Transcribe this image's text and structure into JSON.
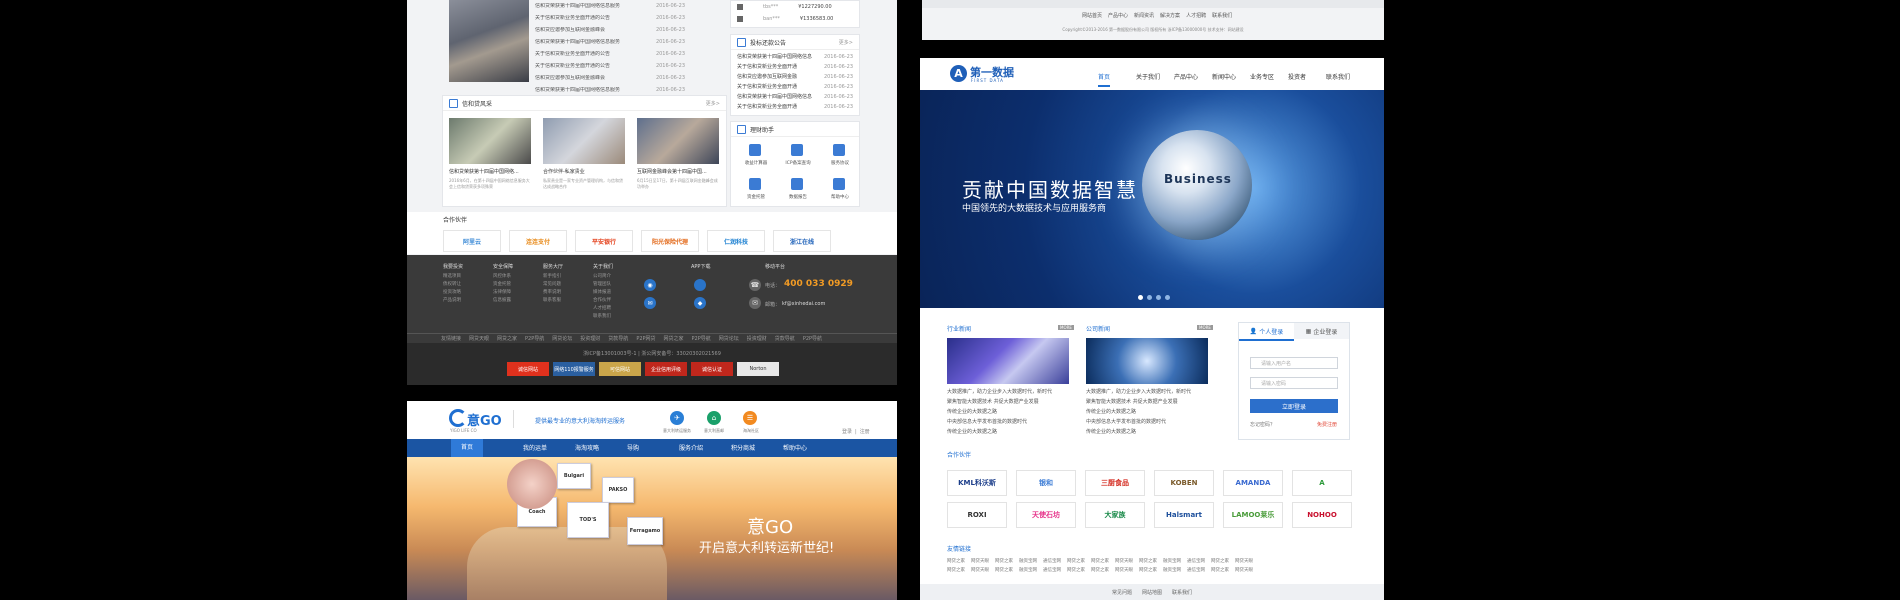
{
  "panel_a": {
    "news": [
      {
        "title": "信和贷荣获第十四届中国网络信息服务",
        "date": "2016-06-23"
      },
      {
        "title": "关于信和贷新业务全面开通的公告",
        "date": "2016-06-23"
      },
      {
        "title": "信和贷应邀参加互联网金融峰会",
        "date": "2016-06-23"
      },
      {
        "title": "信和贷荣获第十四届中国网络信息服务",
        "date": "2016-06-23"
      },
      {
        "title": "关于信和贷新业务全面开通的公告",
        "date": "2016-06-23"
      },
      {
        "title": "关于信和贷新业务全面开通的公告",
        "date": "2016-06-23"
      },
      {
        "title": "信和贷应邀参加互联网金融峰会",
        "date": "2016-06-23"
      },
      {
        "title": "信和贷荣获第十四届中国网络信息服务",
        "date": "2016-06-23"
      }
    ],
    "account_rows": [
      {
        "user": "tbs***",
        "amount": "¥1227290.00"
      },
      {
        "user": "ban***",
        "amount": "¥1336583.00"
      }
    ],
    "notice": {
      "title": "投标还款公告",
      "more": "更多>",
      "items": [
        {
          "title": "信和贷荣获第十四届中国网络信息",
          "date": "2016-06-23"
        },
        {
          "title": "关于信和贷新业务全面开通",
          "date": "2016-06-23"
        },
        {
          "title": "信和贷应邀参加互联网金融",
          "date": "2016-06-23"
        },
        {
          "title": "关于信和贷新业务全面开通",
          "date": "2016-06-23"
        },
        {
          "title": "信和贷荣获第十四届中国网络信息",
          "date": "2016-06-23"
        },
        {
          "title": "关于信和贷新业务全面开通",
          "date": "2016-06-23"
        }
      ]
    },
    "style_section": {
      "title": "信和贷风采",
      "more": "更多>",
      "items": [
        {
          "caption": "信和贷荣获第十四届中国网络...",
          "desc": "2016年6月，在第十四届中国网络信息服务大会上信和贷荣获多项殊荣"
        },
        {
          "caption": "合作伙伴-私家贵业",
          "desc": "私家贵业是一家专业资产管理机构，与信和贷达成战略合作"
        },
        {
          "caption": "互联网金融峰会第十四届中国...",
          "desc": "6月15日至17日，第十四届互联网金融峰会成功举办"
        }
      ]
    },
    "helper": {
      "title": "理财助手",
      "items": [
        "收益计算器",
        "ICP备案查询",
        "服务协议",
        "资金托管",
        "数据报告",
        "帮助中心"
      ]
    },
    "partners": {
      "title": "合作伙伴",
      "logos": [
        "阿里云",
        "连连支付",
        "平安银行",
        "阳光保险代理",
        "仁润科技",
        "浙江在线"
      ]
    },
    "footer": {
      "columns": [
        {
          "title": "我要投资",
          "items": [
            "精选项目",
            "债权转让",
            "投资攻略",
            "产品说明"
          ]
        },
        {
          "title": "安全保障",
          "items": [
            "风控体系",
            "资金托管",
            "法律保障",
            "信息披露"
          ]
        },
        {
          "title": "服务大厅",
          "items": [
            "新手指引",
            "常见问题",
            "费率说明",
            "联系客服"
          ]
        },
        {
          "title": "关于我们",
          "items": [
            "公司简介",
            "管理团队",
            "媒体报道",
            "合作伙伴",
            "人才招聘",
            "联系我们"
          ]
        }
      ],
      "mobile_title": "移动平台",
      "app_title": "APP下载",
      "phone_label": "电话：",
      "phone": "400 033 0929",
      "email_label": "邮箱：",
      "email": "kf@xinhedai.com",
      "links": [
        "友情链接",
        "网贷天眼",
        "网贷之家",
        "P2P导航",
        "网贷论坛",
        "投资理财",
        "贷款导航",
        "P2P网贷",
        "网贷之家",
        "P2P导航",
        "网贷论坛",
        "投资理财",
        "贷款导航",
        "P2P导航"
      ],
      "icp": "浙ICP备13001003号-1 | 浙公网安备号：33020302021569",
      "badges": [
        "诚信网站",
        "网络110报警服务",
        "可信网站",
        "企业信用评级",
        "诚信认证",
        "Norton"
      ]
    }
  },
  "panel_b": {
    "links": [
      "网站首页",
      "产品中心",
      "新闻资讯",
      "解决方案",
      "人才招聘",
      "联系我们"
    ],
    "copyright": "Copyright©2013-2016 第一数据股份有限公司 版权所有   浙ICP备13000000号   技术支持：网站建设"
  },
  "panel_c": {
    "logo": "第一数据",
    "logo_en": "FIRST DATA",
    "nav": [
      "首页",
      "关于我们",
      "产品中心",
      "新闻中心",
      "业务专区",
      "投资者",
      "联系我们"
    ],
    "banner_title": "贡献中国数据智慧",
    "banner_sub": "中国领先的大数据技术与应用服务商",
    "globe_words": "Business",
    "industry_news": {
      "title": "行业新闻",
      "more": "MORE",
      "items": [
        "大数据推广，助力企业步入大数据时代，新时代",
        "聚焦智能大数据技术 共促大数据产业发展",
        "传统企业的大数据之路",
        "中央部信息大学发布首批的数据时代",
        "传统企业的大数据之路"
      ]
    },
    "company_news": {
      "title": "公司新闻",
      "more": "MORE",
      "items": [
        "大数据推广，助力企业步入大数据时代，新时代",
        "聚焦智能大数据技术 共促大数据产业发展",
        "传统企业的大数据之路",
        "中央部信息大学发布首批的数据时代",
        "传统企业的大数据之路"
      ]
    },
    "login": {
      "tab_personal": "个人登录",
      "tab_company": "企业登录",
      "user_placeholder": "请输入用户名",
      "pass_placeholder": "请输入密码",
      "button": "立即登录",
      "forgot": "忘记密码？",
      "register": "免费注册"
    },
    "partners_title": "合作伙伴",
    "partners": [
      "KML科沃斯",
      "银和",
      "三厨食品",
      "KOBEN",
      "AMANDA",
      "A",
      "ROXI",
      "天使石坊",
      "大家族",
      "Halsmart",
      "LAMOO莱乐",
      "NOHOO"
    ],
    "links_title": "友情链接",
    "links": [
      "网贷之家",
      "网贷天眼",
      "网贷之家",
      "融资宝网",
      "通信宝网",
      "网贷之家",
      "网贷之家",
      "网贷天眼",
      "网贷之家",
      "融资宝网",
      "通信宝网",
      "网贷之家",
      "网贷天眼"
    ],
    "footer": [
      "常见问题",
      "网站地图",
      "联系我们"
    ]
  },
  "panel_d": {
    "logo": "意GO",
    "logo_en": "YIGO LIFE CO",
    "slogan": "提供最专业的意大利海淘转运服务",
    "top_icons": [
      "意大利转运服务",
      "意大利直邮",
      "海淘社区"
    ],
    "top_links": [
      "登录",
      "注册"
    ],
    "nav": [
      "首页",
      "我的运单",
      "海淘攻略",
      "导购",
      "服务介绍",
      "积分商城",
      "帮助中心"
    ],
    "hero_title": "意GO",
    "hero_sub": "开启意大利转运新世纪!",
    "cards": [
      "Bulgari",
      "Coach",
      "PAKSO",
      "TOD'S",
      "Ferragamo"
    ]
  }
}
